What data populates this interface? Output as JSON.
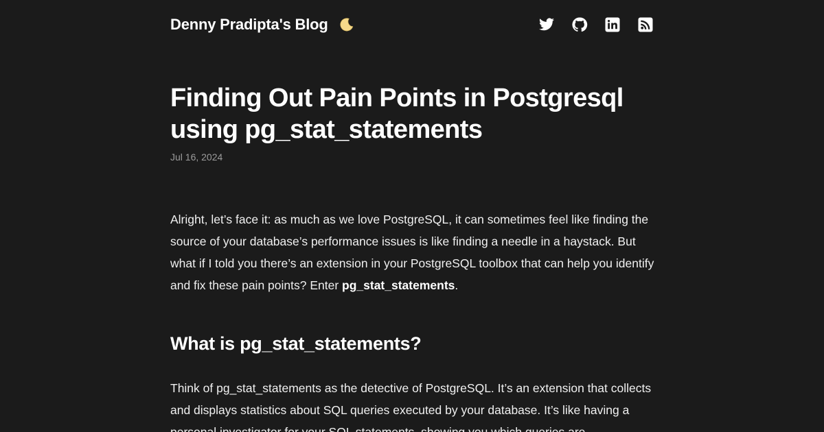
{
  "header": {
    "blog_title": "Denny Pradipta's Blog",
    "theme_icon": "moon-icon",
    "social": [
      {
        "name": "twitter-icon"
      },
      {
        "name": "github-icon"
      },
      {
        "name": "linkedin-icon"
      },
      {
        "name": "rss-icon"
      }
    ]
  },
  "article": {
    "title": "Finding Out Pain Points in Postgresql using pg_stat_statements",
    "date": "Jul 16, 2024",
    "intro_text": "Alright, let’s face it: as much as we love PostgreSQL, it can sometimes feel like finding the source of your database’s performance issues is like finding a needle in a haystack. But what if I told you there’s an extension in your PostgreSQL toolbox that can help you identify and fix these pain points? Enter ",
    "intro_strong": "pg_stat_statements",
    "intro_end": ".",
    "section_heading": "What is pg_stat_statements?",
    "section_text": "Think of pg_stat_statements as the detective of PostgreSQL. It’s an extension that collects and displays statistics about SQL queries executed by your database. It’s like having a personal investigator for your SQL statements, showing you which queries are"
  },
  "colors": {
    "background": "#1b1b1b",
    "text": "#f2f2f2",
    "muted": "#9c9c9c",
    "moon": "#f5d98a"
  }
}
